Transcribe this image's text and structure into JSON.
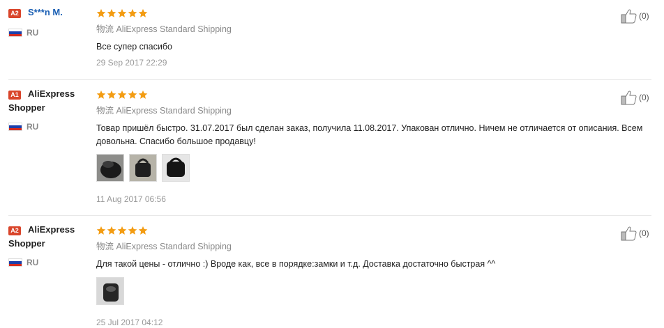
{
  "reviews": [
    {
      "badge": "A2",
      "name_line1": "S***n M.",
      "name_line2": "",
      "country": "RU",
      "stars": 5,
      "shipping": "物流 AliExpress Standard Shipping",
      "text": "Все супер спасибо",
      "date": "29 Sep 2017 22:29",
      "photos": [],
      "likes": "(0)"
    },
    {
      "badge": "A1",
      "name_line1": "AliExpress",
      "name_line2": "Shopper",
      "country": "RU",
      "stars": 5,
      "shipping": "物流 AliExpress Standard Shipping",
      "text": "Товар пришёл быстро. 31.07.2017 был сделан заказ, получила 11.08.2017. Упакован отлично. Ничем не отличается от описания. Всем довольна. Спасибо большое продавцу!",
      "date": "11 Aug 2017 06:56",
      "photos": [
        "photo-1",
        "photo-2",
        "photo-3"
      ],
      "likes": "(0)"
    },
    {
      "badge": "A2",
      "name_line1": "AliExpress",
      "name_line2": "Shopper",
      "country": "RU",
      "stars": 5,
      "shipping": "物流 AliExpress Standard Shipping",
      "text": "Для такой цены - отлично :) Вроде как, все в порядке:замки и т.д. Доставка достаточно быстрая ^^",
      "date": "25 Jul 2017 04:12",
      "photos": [
        "photo-1"
      ],
      "likes": "(0)"
    }
  ],
  "colors": {
    "badge": "#d9452b",
    "star": "#f39c12",
    "name_link": "#1a5fb4"
  },
  "icons": {
    "star": "star-icon",
    "flag": "russia-flag-icon",
    "like": "thumbs-up-icon"
  }
}
